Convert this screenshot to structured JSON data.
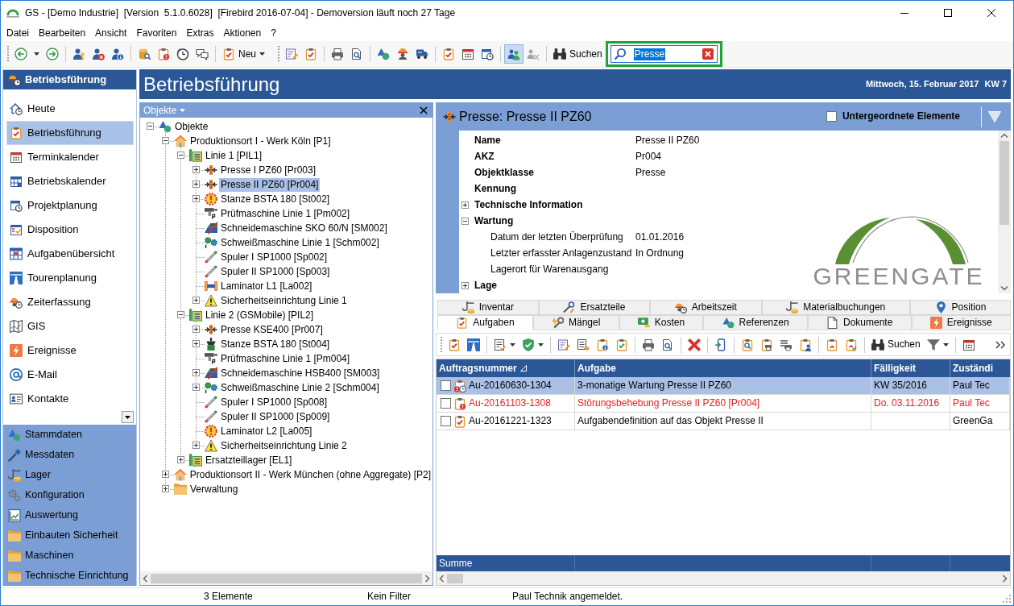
{
  "window": {
    "title": "GS - [Demo Industrie]  [Version  5.1.0.6028]  [Firebird 2016-07-04] - Demoversion läuft noch 27 Tage"
  },
  "menu": [
    "Datei",
    "Bearbeiten",
    "Ansicht",
    "Favoriten",
    "Extras",
    "Aktionen",
    "?"
  ],
  "toolbar": {
    "new_button": {
      "label": "Neu"
    },
    "toggles": [
      {
        "on": true,
        "disabled": false
      },
      {
        "on": false,
        "disabled": true
      }
    ],
    "search_button": {
      "label": "Suchen"
    },
    "search_field": {
      "value": "Presse",
      "value_selected": true,
      "highlighted": true
    }
  },
  "sidebar": {
    "title": "Betriebsführung",
    "items": [
      {
        "label": "Heute",
        "selected": false
      },
      {
        "label": "Betriebsführung",
        "selected": true
      },
      {
        "label": "Terminkalender",
        "selected": false
      },
      {
        "label": "Betriebskalender",
        "selected": false
      },
      {
        "label": "Projektplanung",
        "selected": false
      },
      {
        "label": "Disposition",
        "selected": false
      },
      {
        "label": "Aufgabenübersicht",
        "selected": false
      },
      {
        "label": "Tourenplanung",
        "selected": false
      },
      {
        "label": "Zeiterfassung",
        "selected": false
      },
      {
        "label": "GIS",
        "selected": false
      },
      {
        "label": "Ereignisse",
        "selected": false
      },
      {
        "label": "E-Mail",
        "selected": false
      },
      {
        "label": "Kontakte",
        "selected": false
      }
    ],
    "groups": [
      "Stammdaten",
      "Messdaten",
      "Lager",
      "Konfiguration",
      "Auswertung",
      "Einbauten Sicherheit",
      "Maschinen",
      "Technische Einrichtung"
    ]
  },
  "header": {
    "title": "Betriebsführung",
    "date": "Mittwoch, 15. Februar 2017",
    "week": "KW 7"
  },
  "tree": {
    "title": "Objekte",
    "nodes": [
      {
        "label": "Objekte",
        "kind": "root",
        "expanded": true,
        "selected": false,
        "children": [
          {
            "label": "Produktionsort I - Werk Köln [P1]",
            "kind": "site",
            "expanded": true,
            "selected": false,
            "children": [
              {
                "label": "Linie 1 [PIL1]",
                "kind": "line",
                "expanded": true,
                "selected": false,
                "children": [
                  {
                    "label": "Presse I PZ60 [Pr003]",
                    "kind": "press",
                    "expanded": false,
                    "selected": false
                  },
                  {
                    "label": "Presse II PZ60 [Pr004]",
                    "kind": "press",
                    "expanded": false,
                    "selected": true
                  },
                  {
                    "label": "Stanze BSTA 180 [St002]",
                    "kind": "alert",
                    "expanded": false,
                    "selected": false
                  },
                  {
                    "label": "Prüfmaschine Linie 1 [Pm002]",
                    "kind": "tester",
                    "selected": false
                  },
                  {
                    "label": "Schneidemaschine SKO 60/N [SM002]",
                    "kind": "cutter",
                    "selected": false
                  },
                  {
                    "label": "Schweißmaschine Linie 1 [Schm002]",
                    "kind": "welder",
                    "selected": false
                  },
                  {
                    "label": "Spuler I SP1000 [Sp002]",
                    "kind": "winder",
                    "selected": false
                  },
                  {
                    "label": "Spuler II SP1000 [Sp003]",
                    "kind": "winder",
                    "selected": false
                  },
                  {
                    "label": "Laminator L1 [La002]",
                    "kind": "laminator",
                    "selected": false
                  },
                  {
                    "label": "Sicherheitseinrichtung Linie 1",
                    "kind": "warning",
                    "expanded": false,
                    "selected": false
                  }
                ]
              },
              {
                "label": "Linie 2 (GSMobile) [PIL2]",
                "kind": "line",
                "expanded": true,
                "selected": false,
                "children": [
                  {
                    "label": "Presse KSE400 [Pr007]",
                    "kind": "press",
                    "expanded": false,
                    "selected": false
                  },
                  {
                    "label": "Stanze BSTA 180 [St004]",
                    "kind": "punch",
                    "expanded": false,
                    "selected": false
                  },
                  {
                    "label": "Prüfmaschine Linie 1 [Pm004]",
                    "kind": "tester",
                    "selected": false
                  },
                  {
                    "label": "Schneidemaschine HSB400 [SM003]",
                    "kind": "cutter",
                    "expanded": false,
                    "selected": false
                  },
                  {
                    "label": "Schweißmaschine Linie 2 [Schm004]",
                    "kind": "welder",
                    "expanded": false,
                    "selected": false
                  },
                  {
                    "label": "Spuler I SP1000 [Sp008]",
                    "kind": "winder",
                    "selected": false
                  },
                  {
                    "label": "Spuler II SP1000 [Sp009]",
                    "kind": "winder",
                    "selected": false
                  },
                  {
                    "label": "Laminator L2 [La005]",
                    "kind": "alert",
                    "selected": false
                  },
                  {
                    "label": "Sicherheitseinrichtung Linie 2",
                    "kind": "warning",
                    "expanded": false,
                    "selected": false
                  }
                ]
              },
              {
                "label": "Ersatzteillager [EL1]",
                "kind": "line",
                "expanded": false,
                "selected": false
              }
            ]
          },
          {
            "label": "Produktionsort II - Werk München (ohne Aggregate) [P2]",
            "kind": "site",
            "expanded": false,
            "selected": false
          },
          {
            "label": "Verwaltung",
            "kind": "folder",
            "expanded": false,
            "selected": false
          }
        ]
      }
    ]
  },
  "details": {
    "title": "Presse: Presse II PZ60",
    "sub_elements": {
      "label": "Untergeordnete Elemente",
      "checked": false
    },
    "properties": [
      {
        "kind": "field",
        "label": "Name",
        "value": "Presse II PZ60"
      },
      {
        "kind": "field",
        "label": "AKZ",
        "value": "Pr004"
      },
      {
        "kind": "field",
        "label": "Objektklasse",
        "value": "Presse"
      },
      {
        "kind": "field",
        "label": "Kennung"
      },
      {
        "kind": "group",
        "label": "Technische Information",
        "expanded": false
      },
      {
        "kind": "group",
        "label": "Wartung",
        "expanded": true,
        "children": [
          {
            "label": "Datum der letzten Überprüfung",
            "value": "01.01.2016"
          },
          {
            "label": "Letzter erfasster Anlagenzustand",
            "value": "In Ordnung"
          },
          {
            "label": "Lagerort für Warenausgang"
          }
        ]
      },
      {
        "kind": "group",
        "label": "Lage",
        "expanded": false
      }
    ],
    "logo_text": "GREENGATE"
  },
  "tabs": {
    "back_row": [
      {
        "label": "Inventar",
        "selected": false
      },
      {
        "label": "Ersatzteile",
        "selected": false
      },
      {
        "label": "Arbeitszeit",
        "selected": false
      },
      {
        "label": "Materialbuchungen",
        "selected": false
      },
      {
        "label": "Position",
        "selected": false
      }
    ],
    "front_row": [
      {
        "label": "Aufgaben",
        "selected": true
      },
      {
        "label": "Mängel",
        "selected": false
      },
      {
        "label": "Kosten",
        "selected": false
      },
      {
        "label": "Referenzen",
        "selected": false
      },
      {
        "label": "Dokumente",
        "selected": false
      },
      {
        "label": "Ereignisse",
        "selected": false
      }
    ]
  },
  "task_toolbar": {
    "search_button": {
      "label": "Suchen"
    }
  },
  "table": {
    "columns": [
      {
        "label": "Auftragsnummer",
        "sorted": true
      },
      {
        "label": "Aufgabe",
        "sorted": false
      },
      {
        "label": "Fälligkeit",
        "sorted": false
      },
      {
        "label": "Zuständi",
        "sorted": false
      }
    ],
    "rows": [
      {
        "kind": "recurring",
        "checked": false,
        "selected": true,
        "warning": false,
        "cells": {
          "number": "Au-20160630-1304",
          "task": "3-monatige Wartung Presse II PZ60",
          "due": "KW 35/2016",
          "column_4": "Paul Tec"
        }
      },
      {
        "kind": "fault",
        "checked": false,
        "selected": false,
        "warning": true,
        "cells": {
          "number": "Au-20161103-1308",
          "task": "Störungsbehebung Presse II PZ60 [Pr004]",
          "due": "Do. 03.11.2016",
          "column_4": "Paul Tec"
        }
      },
      {
        "kind": "task",
        "checked": false,
        "selected": false,
        "warning": false,
        "cells": {
          "number": "Au-20161221-1323",
          "task": "Aufgabendefinition auf das Objekt Presse II",
          "column_4": "GreenGa"
        }
      }
    ],
    "footer": "Summe"
  },
  "status_bar": [
    "3 Elemente",
    "Kein Filter",
    "Paul Technik angemeldet."
  ]
}
